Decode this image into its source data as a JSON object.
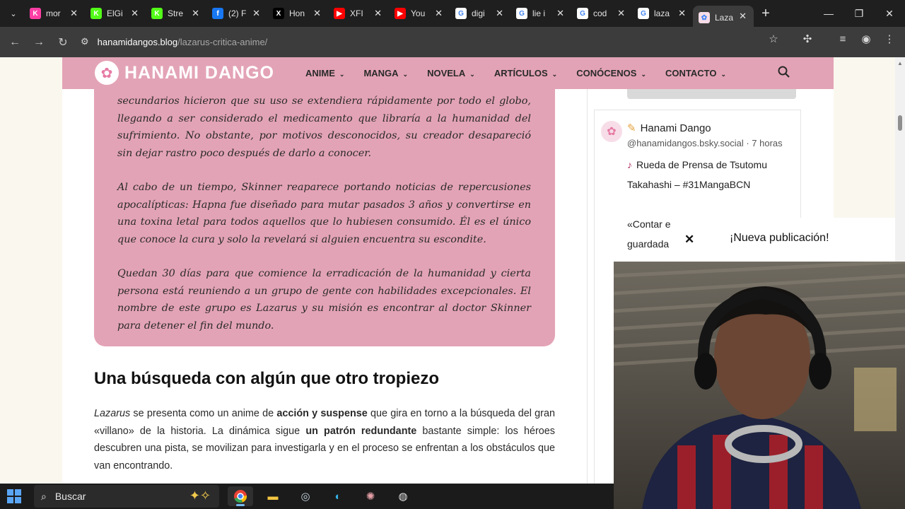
{
  "browser": {
    "tabs": [
      {
        "title": "mor",
        "icon": "kick-icon",
        "color": "#ff3ea5",
        "glyph": "K"
      },
      {
        "title": "ElGi",
        "icon": "kick-icon",
        "color": "#53fc18",
        "glyph": "K"
      },
      {
        "title": "Stre",
        "icon": "kick-icon",
        "color": "#53fc18",
        "glyph": "K"
      },
      {
        "title": "(2) F",
        "icon": "facebook-icon",
        "color": "#1877f2",
        "glyph": "f"
      },
      {
        "title": "Hon",
        "icon": "x-icon",
        "color": "#000000",
        "glyph": "X"
      },
      {
        "title": "XFI",
        "icon": "youtube-icon",
        "color": "#ff0000",
        "glyph": "▶"
      },
      {
        "title": "You",
        "icon": "youtube-icon",
        "color": "#ff0000",
        "glyph": "▶"
      },
      {
        "title": "digi",
        "icon": "google-icon",
        "color": "#ffffff",
        "glyph": "G"
      },
      {
        "title": "lie i",
        "icon": "google-icon",
        "color": "#ffffff",
        "glyph": "G"
      },
      {
        "title": "cod",
        "icon": "google-icon",
        "color": "#ffffff",
        "glyph": "G"
      },
      {
        "title": "laza",
        "icon": "google-icon",
        "color": "#ffffff",
        "glyph": "G"
      },
      {
        "title": "Laza",
        "icon": "hanami-icon",
        "color": "#f7dde7",
        "glyph": "✿",
        "active": true
      }
    ],
    "url_host": "hanamidangos.blog",
    "url_path": "/lazarus-critica-anime/"
  },
  "site": {
    "logo_text": "HANAMI DANGO",
    "menu": [
      "ANIME",
      "MANGA",
      "NOVELA",
      "ARTÍCULOS",
      "CONÓCENOS",
      "CONTACTO"
    ],
    "accent_color": "#e3a3b6"
  },
  "article": {
    "paragraphs": [
      "secundarios hicieron que su uso se extendiera rápidamente por todo el globo, llegando a ser considerado el medicamento que libraría a la humanidad del sufrimiento. No obstante, por motivos desconocidos, su creador desapareció sin dejar rastro poco después de darlo a conocer.",
      "Al cabo de un tiempo, Skinner reaparece portando noticias de repercusiones apocalípticas: Hapna fue diseñado para mutar pasados 3 años y convertirse en una toxina letal para todos aquellos que lo hubiesen consumido. Él es el único que conoce la cura y solo la revelará si alguien encuentra su escondite.",
      "Quedan 30 días para que comience la erradicación de la humanidad y cierta persona está reuniendo a un grupo de gente con habilidades excepcionales. El nombre de este grupo es Lazarus y su misión es encontrar al doctor Skinner para detener el fin del mundo."
    ],
    "heading": "Una búsqueda con algún que otro tropiezo",
    "body": {
      "p1": "Lazarus",
      "p2": " se presenta como un anime de ",
      "p3": "acción y suspense",
      "p4": " que gira en torno a la búsqueda del gran «villano» de la historia. La dinámica sigue ",
      "p5": "un patrón redundante",
      "p6": " bastante simple: los héroes descubren una pista, se movilizan para investigarla y en el proceso se enfrentan a los obstáculos que van encontrando."
    }
  },
  "sidebar": {
    "name": "Hanami Dango",
    "handle": "@hanamidangos.bsky.social",
    "time": "7 horas",
    "post_line1": "Rueda de Prensa de Tsutomu",
    "post_line2": "Takahashi – #31MangaBCN",
    "post_line3": "«Contar e",
    "post_line4": "guardada"
  },
  "notification": {
    "title": "¡Nueva publicación!"
  },
  "taskbar": {
    "search_label": "Buscar",
    "apps": [
      "chrome-icon",
      "file-explorer-icon",
      "steam-icon",
      "edge-icon",
      "game-icon",
      "obs-icon"
    ]
  }
}
